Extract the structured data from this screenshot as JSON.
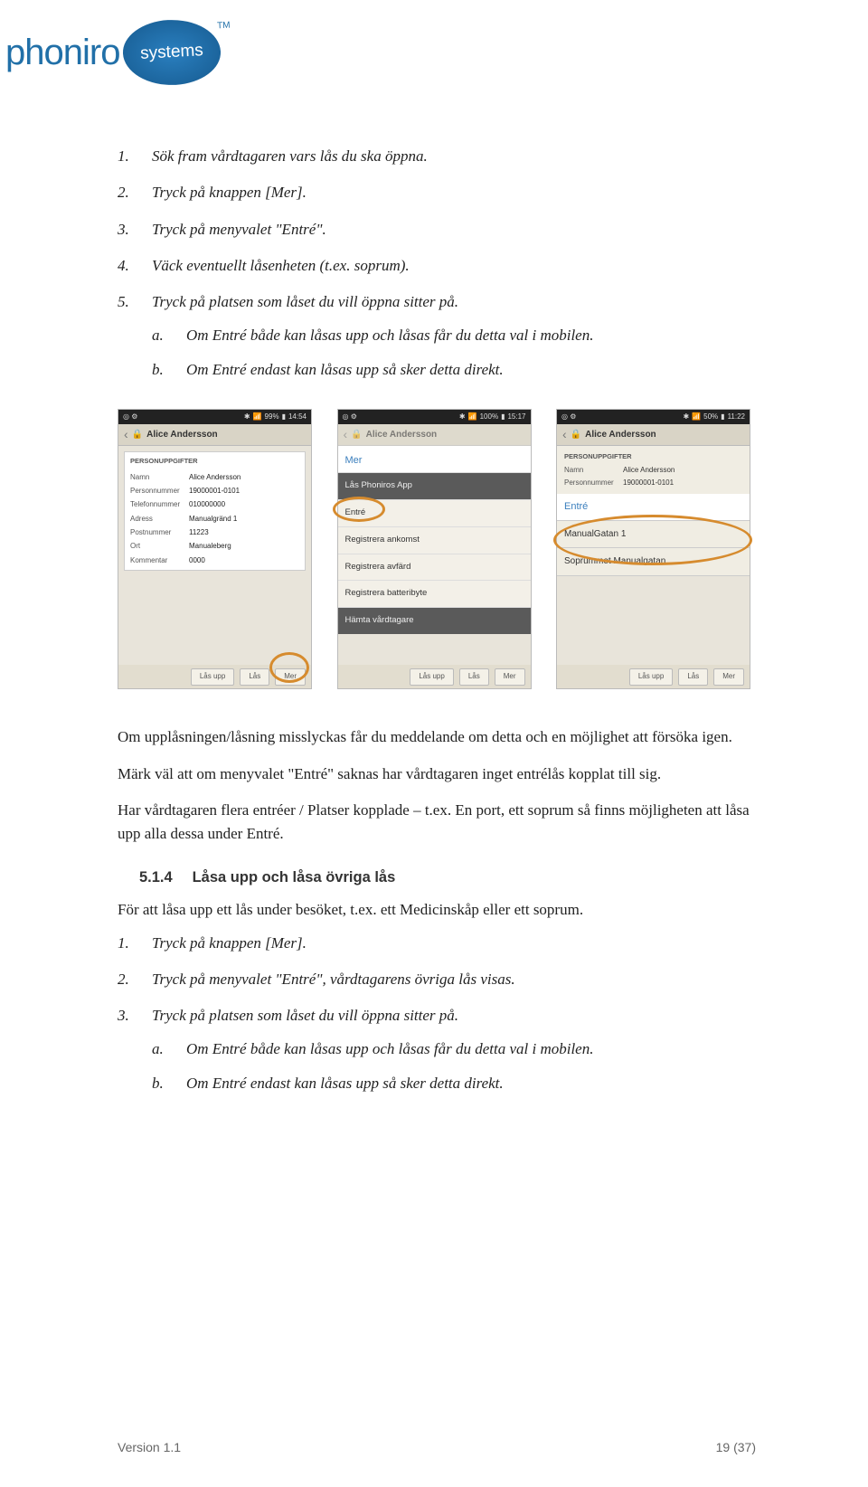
{
  "logo": {
    "text": "phoniro",
    "badge": "systems",
    "tm": "TM"
  },
  "steps_top": {
    "s1": "Sök fram vårdtagaren vars lås du ska öppna.",
    "s2": "Tryck på knappen [Mer].",
    "s3": "Tryck på menyvalet \"Entré\".",
    "s4": "Väck eventuellt låsenheten (t.ex. soprum).",
    "s5": "Tryck på platsen som låset du vill öppna sitter på.",
    "s5a": "Om Entré både kan låsas upp och låsas får du detta val i mobilen.",
    "s5b": "Om Entré endast kan låsas upp så sker detta direkt."
  },
  "screens": {
    "person_name": "Alice Andersson",
    "statusbar": {
      "batt1": "99%",
      "t1": "14:54",
      "batt2": "100%",
      "t2": "15:17",
      "batt3": "50%",
      "t3": "11:22",
      "bt": "⚪"
    },
    "s1": {
      "section": "PERSONUPPGIFTER",
      "rows": {
        "namn_k": "Namn",
        "namn_v": "Alice Andersson",
        "pn_k": "Personnummer",
        "pn_v": "19000001-0101",
        "tel_k": "Telefonnummer",
        "tel_v": "010000000",
        "adr_k": "Adress",
        "adr_v": "Manualgränd 1",
        "post_k": "Postnummer",
        "post_v": "11223",
        "ort_k": "Ort",
        "ort_v": "Manualeberg",
        "kom_k": "Kommentar",
        "kom_v": "0000"
      },
      "buttons": {
        "b1": "Lås upp",
        "b2": "Lås",
        "b3": "Mer"
      }
    },
    "s2": {
      "hdr": "Mer",
      "items": {
        "i1": "Lås Phoniros App",
        "i2": "Entré",
        "i3": "Registrera ankomst",
        "i4": "Registrera avfärd",
        "i5": "Registrera batteribyte",
        "i6": "Hämta vårdtagare"
      },
      "buttons": {
        "b1": "Lås upp",
        "b2": "Lås",
        "b3": "Mer"
      }
    },
    "s3": {
      "section": "PERSONUPPGIFTER",
      "rows": {
        "namn_k": "Namn",
        "namn_v": "Alice Andersson",
        "pn_k": "Personnummer",
        "pn_v": "19000001-0101"
      },
      "hdr": "Entré",
      "loc1": "ManualGatan 1",
      "loc2": "Soprummet Manualgatan",
      "buttons": {
        "b1": "Lås upp",
        "b2": "Lås",
        "b3": "Mer"
      }
    }
  },
  "paras": {
    "p1": "Om upplåsningen/låsning misslyckas får du meddelande om detta och en möjlighet att försöka igen.",
    "p2": "Märk väl att om menyvalet \"Entré\" saknas har vårdtagaren inget entrélås kopplat till sig.",
    "p3": "Har vårdtagaren flera entréer / Platser kopplade – t.ex. En port, ett soprum så finns möjligheten att låsa upp alla dessa under Entré."
  },
  "section": {
    "num": "5.1.4",
    "title": "Låsa upp och låsa övriga lås"
  },
  "intro_514": "För att låsa upp ett lås under besöket, t.ex. ett Medicinskåp eller ett soprum.",
  "steps_514": {
    "s1": "Tryck på knappen [Mer].",
    "s2": "Tryck på menyvalet \"Entré\", vårdtagarens övriga lås visas.",
    "s3": "Tryck på platsen som låset du vill öppna sitter på.",
    "s3a": "Om Entré både kan låsas upp och låsas får du detta val i mobilen.",
    "s3b": "Om Entré endast kan låsas upp så sker detta direkt."
  },
  "footer": {
    "version": "Version 1.1",
    "page": "19 (37)"
  }
}
